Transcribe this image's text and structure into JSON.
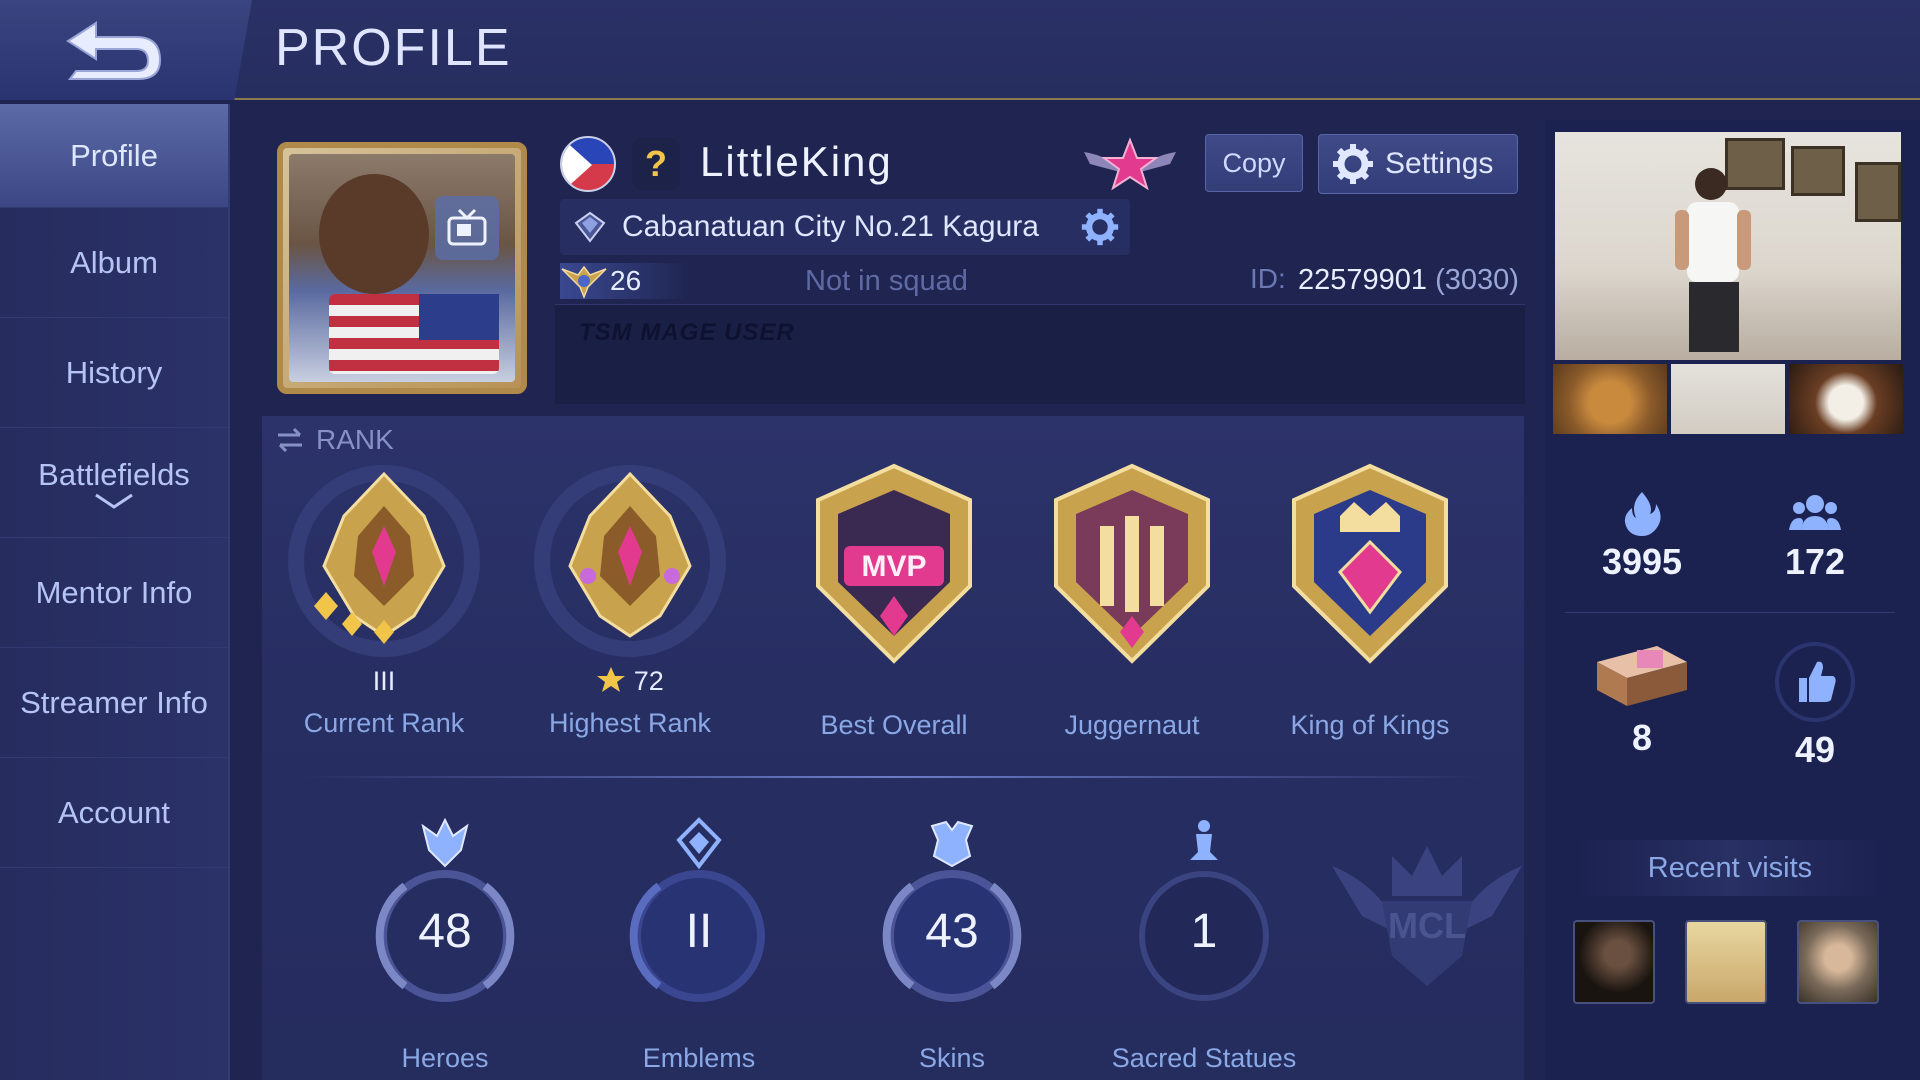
{
  "header": {
    "title": "PROFILE"
  },
  "sidebar": {
    "items": [
      {
        "label": "Profile",
        "active": true
      },
      {
        "label": "Album"
      },
      {
        "label": "History"
      },
      {
        "label": "Battlefields",
        "has_chevron": true
      },
      {
        "label": "Mentor Info"
      },
      {
        "label": "Streamer Info"
      },
      {
        "label": "Account"
      }
    ]
  },
  "profile": {
    "country": "Philippines",
    "username": "LittleKing",
    "copy_label": "Copy",
    "settings_label": "Settings",
    "squad": "Cabanatuan City No.21 Kagura",
    "level": "26",
    "squad_status": "Not in squad",
    "id_label": "ID:",
    "id_value": "22579901",
    "id_extra": "(3030)",
    "motto": "TSM MAGE USER"
  },
  "rank": {
    "header": "RANK",
    "medals": [
      {
        "label": "Current Rank",
        "sub": "III",
        "icon": "mythic-medal-icon"
      },
      {
        "label": "Highest Rank",
        "sub": "72",
        "icon": "mythic-glory-medal-icon"
      },
      {
        "label": "Best Overall",
        "icon": "mvp-badge-icon"
      },
      {
        "label": "Juggernaut",
        "icon": "juggernaut-badge-icon"
      },
      {
        "label": "King of Kings",
        "icon": "king-of-kings-badge-icon"
      }
    ],
    "stats": [
      {
        "label": "Heroes",
        "value": "48",
        "icon": "heroes-icon"
      },
      {
        "label": "Emblems",
        "value": "II",
        "icon": "emblems-icon"
      },
      {
        "label": "Skins",
        "value": "43",
        "icon": "skins-icon"
      },
      {
        "label": "Sacred Statues",
        "value": "1",
        "icon": "statue-icon"
      }
    ],
    "mcl_label": "MCL"
  },
  "side_stats": {
    "popularity": "3995",
    "followers": "172",
    "gifts": "8",
    "likes": "49"
  },
  "recent_visits": {
    "title": "Recent visits"
  },
  "colors": {
    "background": "#1f2550",
    "accent_gold": "#b08a4a",
    "label_blue": "#8aa8e6"
  }
}
